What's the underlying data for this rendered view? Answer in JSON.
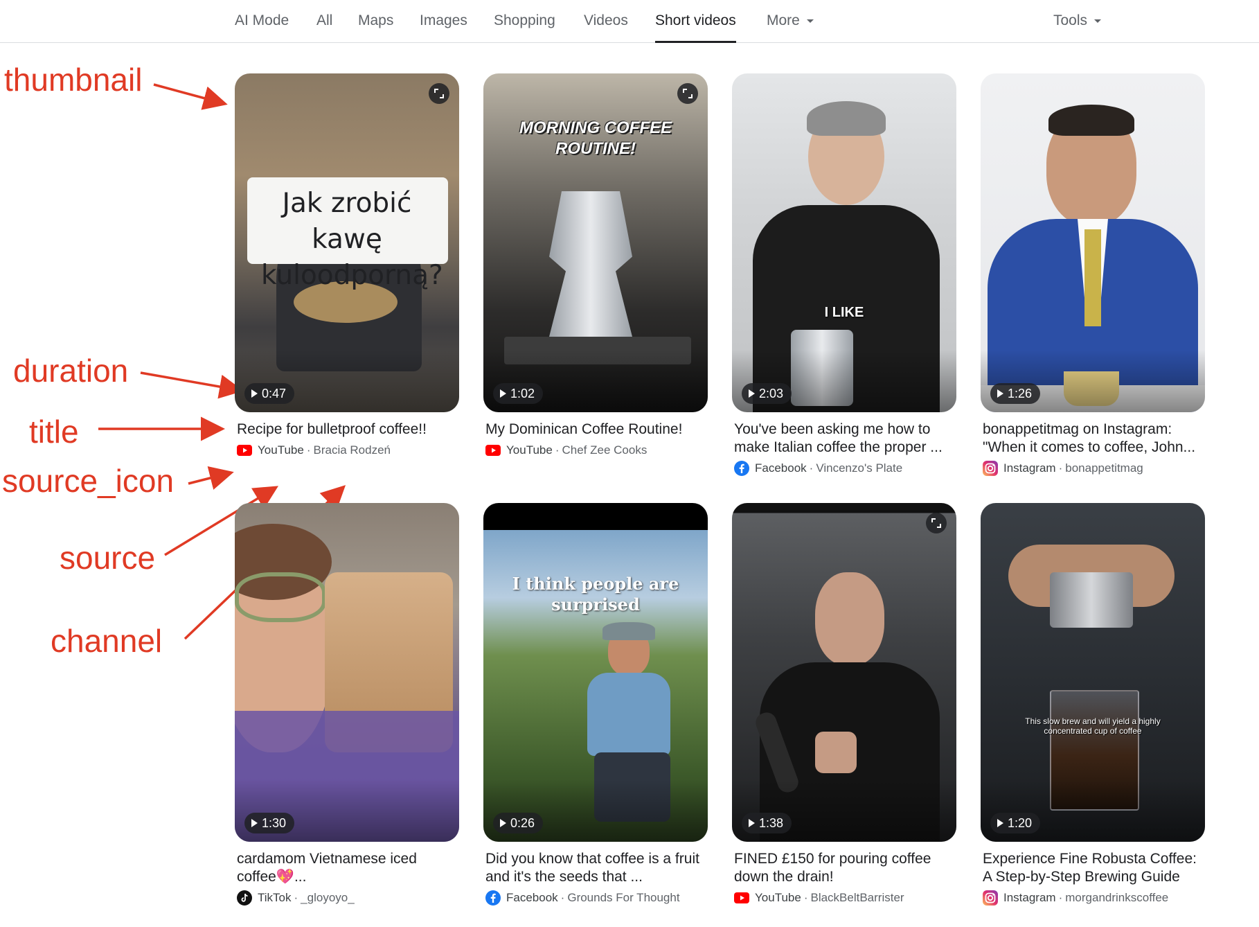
{
  "tabs": [
    {
      "label": "AI Mode"
    },
    {
      "label": "All"
    },
    {
      "label": "Maps"
    },
    {
      "label": "Images"
    },
    {
      "label": "Shopping"
    },
    {
      "label": "Videos"
    },
    {
      "label": "Short videos",
      "active": true
    },
    {
      "label": "More",
      "dropdown": true
    }
  ],
  "tools_label": "Tools",
  "annotations": {
    "thumbnail": "thumbnail",
    "duration": "duration",
    "title": "title",
    "source_icon": "source_icon",
    "source": "source",
    "channel": "channel",
    "color": "#e03a24"
  },
  "cards": [
    {
      "duration": "0:47",
      "title": "Recipe for bulletproof coffee!!",
      "source": "YouTube",
      "channel": "Bracia Rodzeń",
      "source_icon": "youtube-icon",
      "overlay": "Jak zrobić kawę kuloodporną?",
      "expand": true
    },
    {
      "duration": "1:02",
      "title": "My Dominican Coffee Routine!",
      "source": "YouTube",
      "channel": "Chef Zee Cooks",
      "source_icon": "youtube-icon",
      "overlay": "MORNING COFFEE ROUTINE!",
      "expand": true
    },
    {
      "duration": "2:03",
      "title": "You've been asking me how to make Italian coffee the proper ...",
      "source": "Facebook",
      "channel": "Vincenzo's Plate",
      "source_icon": "facebook-icon",
      "overlay": "I LIKE",
      "expand": false
    },
    {
      "duration": "1:26",
      "title": "bonappetitmag on Instagram: \"When it comes to coffee, John...",
      "source": "Instagram",
      "channel": "bonappetitmag",
      "source_icon": "instagram-icon",
      "overlay": "",
      "expand": false
    },
    {
      "duration": "1:30",
      "title": "cardamom Vietnamese iced coffee💖...",
      "source": "TikTok",
      "channel": "_gloyoyo_",
      "source_icon": "tiktok-icon",
      "overlay": "",
      "expand": false
    },
    {
      "duration": "0:26",
      "title": "Did you know that coffee is a fruit and it's the seeds that ...",
      "source": "Facebook",
      "channel": "Grounds For Thought",
      "source_icon": "facebook-icon",
      "overlay": "I think people are surprised",
      "expand": false
    },
    {
      "duration": "1:38",
      "title": "FINED £150 for pouring coffee down the drain!",
      "source": "YouTube",
      "channel": "BlackBeltBarrister",
      "source_icon": "youtube-icon",
      "overlay": "",
      "expand": true
    },
    {
      "duration": "1:20",
      "title": "Experience Fine Robusta Coffee: A Step-by-Step Brewing Guide",
      "source": "Instagram",
      "channel": "morgandrinkscoffee",
      "source_icon": "instagram-icon",
      "overlay": "This slow brew and will yield a highly concentrated cup of coffee",
      "expand": false
    }
  ]
}
